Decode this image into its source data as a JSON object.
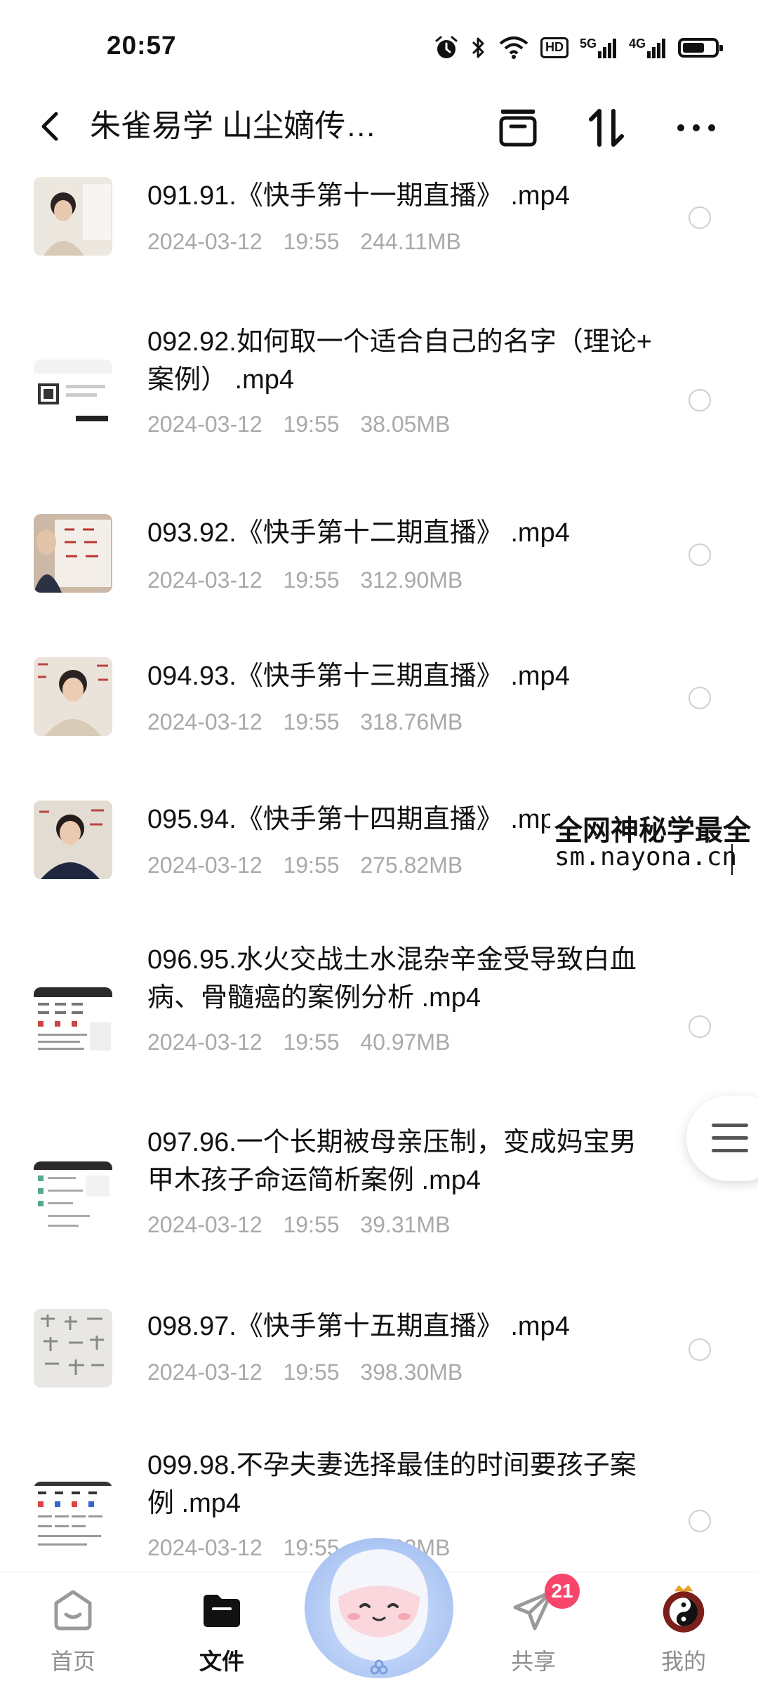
{
  "status_bar": {
    "time": "20:57",
    "hd": "HD",
    "net1": "5G",
    "net2": "4G"
  },
  "header": {
    "title": "朱雀易学 山尘嫡传…"
  },
  "files": [
    {
      "name": "091.91.《快手第十一期直播》 .mp4",
      "date": "2024-03-12",
      "time": "19:55",
      "size": "244.11MB"
    },
    {
      "name": "092.92.如何取一个适合自己的名字（理论+ 案例） .mp4",
      "date": "2024-03-12",
      "time": "19:55",
      "size": "38.05MB"
    },
    {
      "name": "093.92.《快手第十二期直播》 .mp4",
      "date": "2024-03-12",
      "time": "19:55",
      "size": "312.90MB"
    },
    {
      "name": "094.93.《快手第十三期直播》 .mp4",
      "date": "2024-03-12",
      "time": "19:55",
      "size": "318.76MB"
    },
    {
      "name": "095.94.《快手第十四期直播》 .mp4",
      "date": "2024-03-12",
      "time": "19:55",
      "size": "275.82MB"
    },
    {
      "name": "096.95.水火交战土水混杂辛金受导致白血病、骨髓癌的案例分析 .mp4",
      "date": "2024-03-12",
      "time": "19:55",
      "size": "40.97MB"
    },
    {
      "name": "097.96.一个长期被母亲压制，变成妈宝男甲木孩子命运简析案例 .mp4",
      "date": "2024-03-12",
      "time": "19:55",
      "size": "39.31MB"
    },
    {
      "name": "098.97.《快手第十五期直播》 .mp4",
      "date": "2024-03-12",
      "time": "19:55",
      "size": "398.30MB"
    },
    {
      "name": "099.98.不孕夫妻选择最佳的时间要孩子案例 .mp4",
      "date": "2024-03-12",
      "time": "19:55",
      "size": "38.32MB"
    }
  ],
  "watermark": {
    "line1": "全网神秘学最全",
    "line2": "sm.nayona.cn"
  },
  "nav": {
    "home": "首页",
    "files": "文件",
    "share": "共享",
    "share_badge": "21",
    "mine": "我的"
  },
  "colors": {
    "meta_text": "#a9a9a9",
    "badge": "#f8456b",
    "inactive_nav": "#8e8e8e"
  }
}
